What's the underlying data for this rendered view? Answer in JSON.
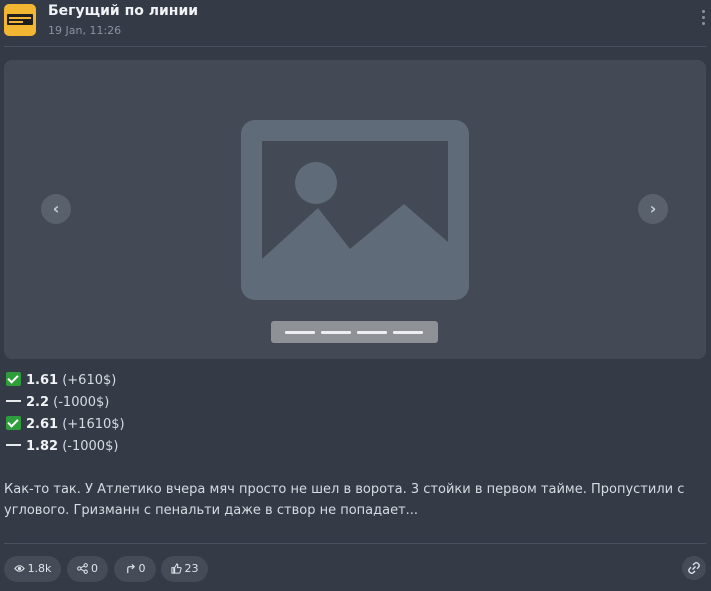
{
  "header": {
    "channel_name": "Бегущий по линии",
    "timestamp": "19 Jan, 11:26",
    "menu_icon": "more-vertical-icon"
  },
  "media": {
    "placeholder_icon": "image-placeholder-icon",
    "prev_icon": "chevron-left-icon",
    "next_icon": "chevron-right-icon",
    "prev_glyph": "‹",
    "next_glyph": "›"
  },
  "bets": [
    {
      "status": "win",
      "icon": "check-mark-icon",
      "odds": "1.61",
      "result": "(+610$)"
    },
    {
      "status": "loss",
      "icon": "dash-icon",
      "odds": "2.2",
      "result": "(-1000$)"
    },
    {
      "status": "win",
      "icon": "check-mark-icon",
      "odds": "2.61",
      "result": "(+1610$)"
    },
    {
      "status": "loss",
      "icon": "dash-icon",
      "odds": "1.82",
      "result": "(-1000$)"
    }
  ],
  "post": {
    "line1": "Как-то так. У Атлетико вчера мяч просто не шел в ворота. 3 стойки в первом тайме. Пропустили с",
    "line2": "углового. Гризманн с пенальти даже в створ не попадает..."
  },
  "actions": {
    "views": "1.8k",
    "shares": "0",
    "forwards": "0",
    "likes": "23"
  },
  "colors": {
    "background": "#343a46",
    "media_bg": "#434a55",
    "placeholder": "#5f6b79",
    "check_green": "#2e9e3c",
    "avatar_yellow": "#f2b632"
  }
}
